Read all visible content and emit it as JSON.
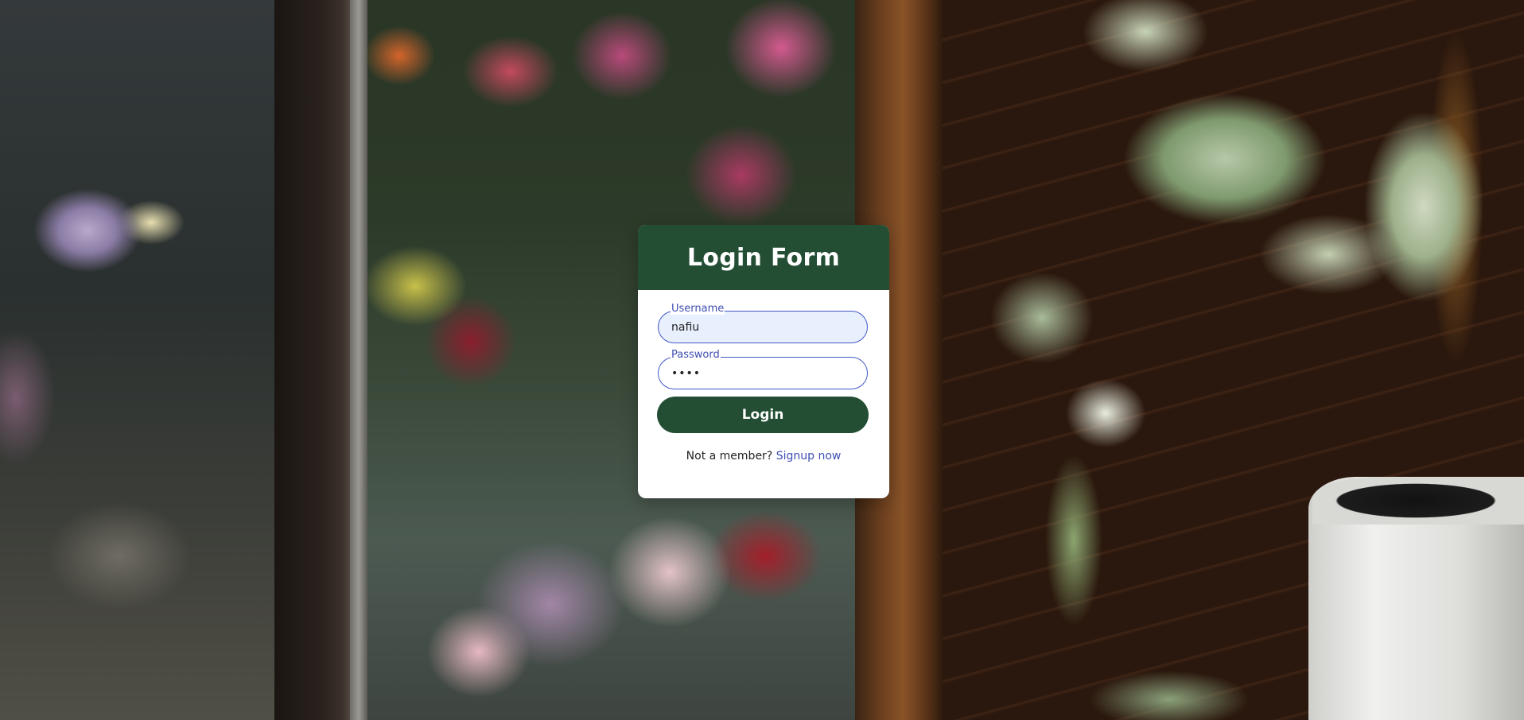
{
  "login": {
    "title": "Login Form",
    "username": {
      "label": "Username",
      "value": "nafiu"
    },
    "password": {
      "label": "Password",
      "value": "••••"
    },
    "button_label": "Login",
    "signup_prompt": "Not a member?",
    "signup_link": "Signup now"
  },
  "colors": {
    "header_bg": "#234e34",
    "button_bg": "#234e34",
    "accent_link": "#3f4eb3",
    "field_border": "#4358c7"
  }
}
